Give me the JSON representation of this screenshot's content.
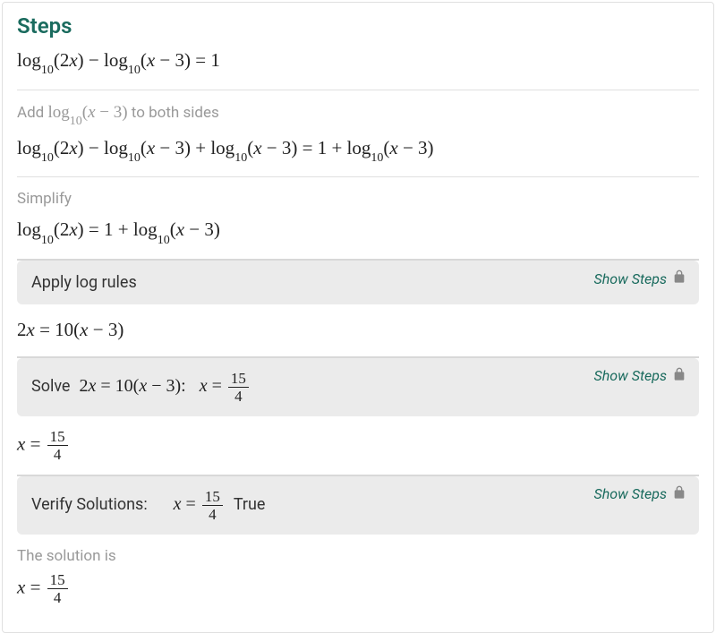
{
  "title": "Steps",
  "original_equation": "log₁₀(2x) − log₁₀(x − 3) = 1",
  "step1": {
    "instruction_prefix": "Add ",
    "instruction_math": "log₁₀(x − 3)",
    "instruction_suffix": " to both sides",
    "result": "log₁₀(2x) − log₁₀(x − 3) + log₁₀(x − 3) = 1 + log₁₀(x − 3)"
  },
  "step2": {
    "instruction": "Simplify",
    "result": "log₁₀(2x) = 1 + log₁₀(x − 3)"
  },
  "step3": {
    "label": "Apply log rules",
    "show_steps": "Show Steps",
    "result": "2x = 10(x − 3)"
  },
  "step4": {
    "label_prefix": "Solve ",
    "label_math": "2x = 10(x − 3):",
    "label_answer_prefix": "x = ",
    "frac_num": "15",
    "frac_den": "4",
    "show_steps": "Show Steps",
    "result_prefix": "x = "
  },
  "step5": {
    "label_prefix": "Verify Solutions:",
    "label_answer_prefix": "x = ",
    "frac_num": "15",
    "frac_den": "4",
    "label_suffix": "True",
    "show_steps": "Show Steps"
  },
  "final": {
    "label": "The solution is",
    "result_prefix": "x = ",
    "frac_num": "15",
    "frac_den": "4"
  }
}
